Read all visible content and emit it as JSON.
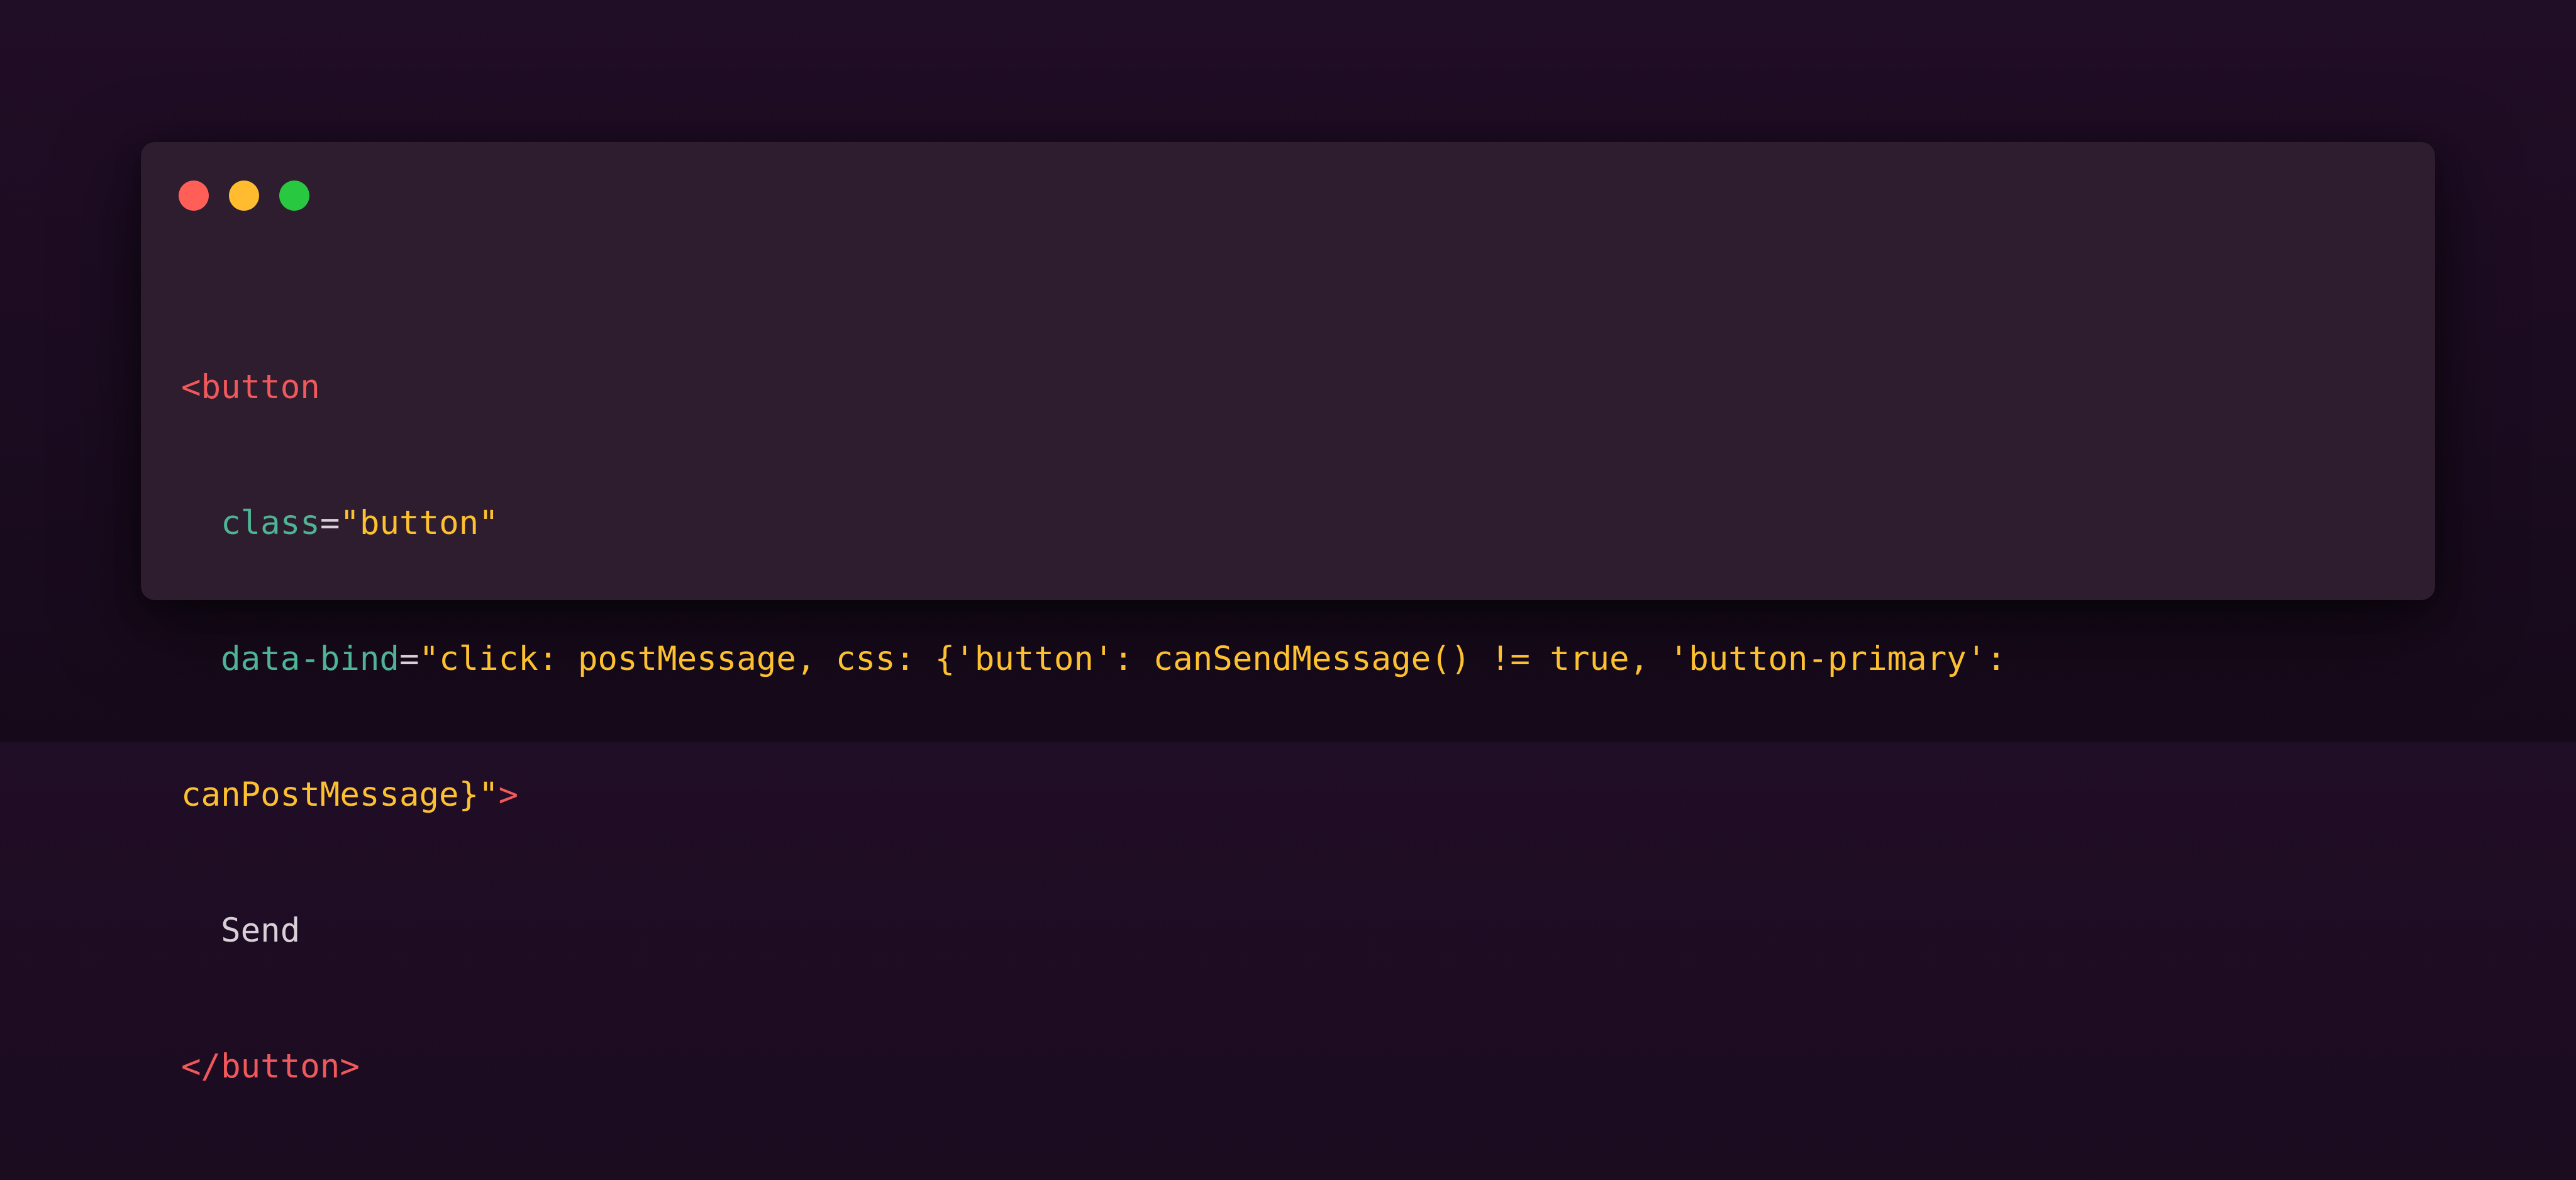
{
  "window": {
    "controls": [
      {
        "name": "close",
        "color": "#ff5f57"
      },
      {
        "name": "minimize",
        "color": "#febc2e"
      },
      {
        "name": "zoom",
        "color": "#28c840"
      }
    ]
  },
  "code": {
    "line1": {
      "open_tag": "<button"
    },
    "line2": {
      "indent": "  ",
      "attr": "class",
      "eq": "=",
      "value": "\"button\""
    },
    "line3": {
      "indent": "  ",
      "attr": "data-bind",
      "eq": "=",
      "value": "\"click: postMessage, css: {'button': canSendMessage() != true, 'button-primary':"
    },
    "line4": {
      "value": "canPostMessage}\"",
      "close_bracket": ">"
    },
    "line5": {
      "indent": "  ",
      "text": "Send"
    },
    "line6": {
      "close_tag": "</button>"
    }
  },
  "colors": {
    "background": "#1c0c21",
    "window": "#2e1d2e",
    "tag": "#f0595c",
    "attribute": "#4fb396",
    "string": "#fdc02f",
    "text": "#d8d0d6"
  }
}
